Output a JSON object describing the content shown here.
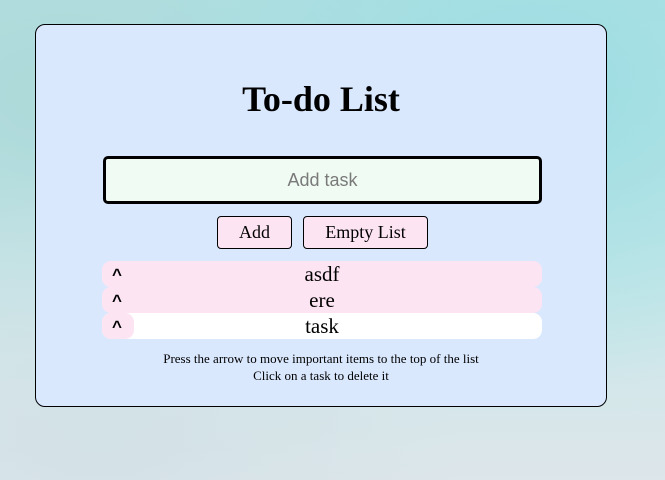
{
  "app": {
    "title": "To-do List"
  },
  "input": {
    "placeholder": "Add task",
    "value": ""
  },
  "buttons": {
    "add_label": "Add",
    "empty_label": "Empty List"
  },
  "tasks": [
    {
      "arrow": "^",
      "text": "asdf"
    },
    {
      "arrow": "^",
      "text": "ere"
    },
    {
      "arrow": "^",
      "text": "task"
    }
  ],
  "hints": {
    "line1": "Press the arrow to move important items to the top of the list",
    "line2": "Click on a task to delete it"
  },
  "colors": {
    "card_background": "#dae8fe",
    "button_background": "#fce4f3",
    "input_background": "#f0fbf3"
  }
}
